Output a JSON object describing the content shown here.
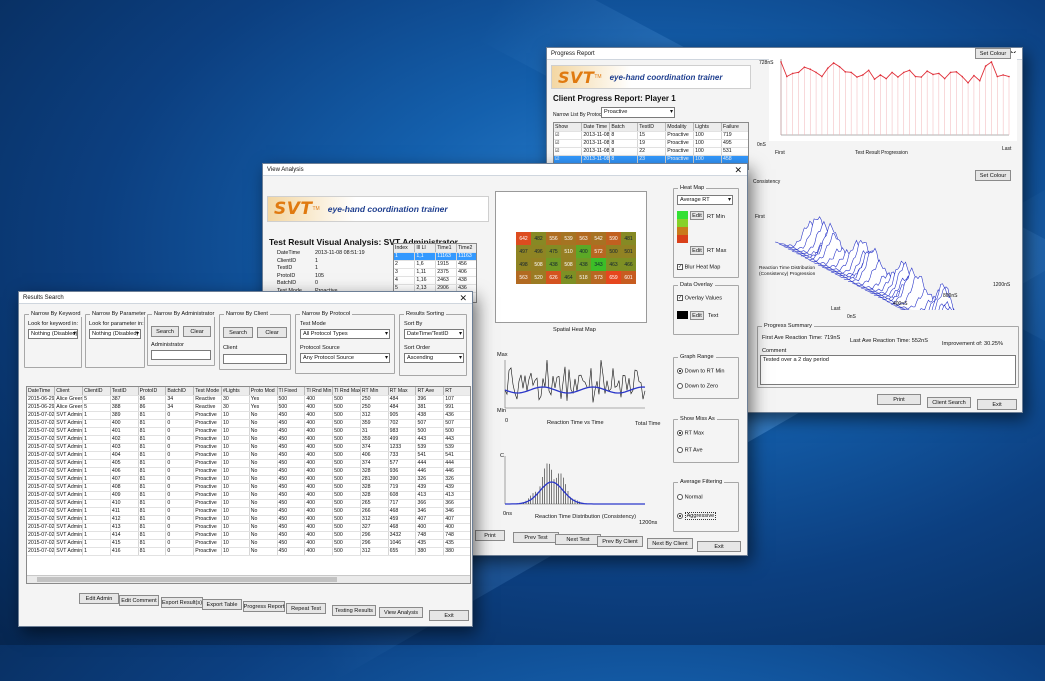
{
  "progress": {
    "title": "Progress Report",
    "logo": {
      "svt": "SVT",
      "tm": "TM",
      "tagline": "eye-hand coordination trainer"
    },
    "heading": "Client Progress Report: Player 1",
    "narrow_label": "Narrow List By Protocol",
    "narrow_value": "Proactive",
    "columns": [
      "Show",
      "Date Time",
      "Batch",
      "TestID",
      "Modality",
      "Lights",
      "Failure"
    ],
    "rows": [
      [
        "☑",
        "2013-11-08 13:04:37",
        "8",
        "15",
        "Proactive",
        "100",
        "719"
      ],
      [
        "☑",
        "2013-11-08 13:40:05",
        "8",
        "19",
        "Proactive",
        "100",
        "495"
      ],
      [
        "☑",
        "2013-11-08 13:55:52",
        "8",
        "22",
        "Proactive",
        "100",
        "531"
      ],
      [
        "☑",
        "2013-11-08 13:57:36",
        "8",
        "23",
        "Proactive",
        "100",
        "458"
      ],
      [
        "☑",
        "2013-11-08 14:00:11",
        "8",
        "24",
        "Proactive",
        "100",
        "446"
      ]
    ],
    "set_colour": "Set Colour",
    "line_chart": {
      "ymax": "728nS",
      "ymin": "0nS",
      "xfirst": "First",
      "xlabel": "Test Result Progression",
      "xlast": "Last",
      "values": [
        700,
        560,
        590,
        600,
        650,
        630,
        600,
        560,
        640,
        690,
        655,
        605,
        600,
        555,
        575,
        620,
        535,
        575,
        540,
        600,
        555,
        600,
        620,
        560,
        555,
        612,
        580,
        590,
        540,
        600,
        605,
        560,
        500,
        570,
        520,
        660,
        700,
        560,
        575,
        560
      ]
    },
    "dist3d": {
      "consistency": "Consistency",
      "first": "First",
      "last": "Last",
      "ylabel": "Reaction Time Distribution (Consistency) Progression",
      "x0": "0nS",
      "x400": "400nS",
      "x800": "800nS",
      "x1200": "1200nS"
    },
    "summary": {
      "legend": "Progress Summary",
      "first_ave": "First Ave Reaction Time: 719nS",
      "last_ave": "Last Ave Reaction Time: 552nS",
      "improvement": "Improvement of: 30.25%",
      "comment_label": "Comment",
      "comment": "Tested over a 2 day period"
    },
    "buttons": [
      "Print",
      "Client Search",
      "Exit"
    ]
  },
  "analysis": {
    "title": "View Analysis",
    "logo": {
      "svt": "SVT",
      "tm": "TM",
      "tagline": "eye-hand coordination trainer"
    },
    "heading": "Test Result Visual Analysis: SVT Administrator",
    "info": [
      [
        "DateTime",
        "2013-11-08 08:51:19"
      ],
      [
        "ClientID",
        "1"
      ],
      [
        "TestID",
        "1"
      ],
      [
        "ProtoID",
        "105"
      ],
      [
        "BatchID",
        "0"
      ],
      [
        "Test Mode",
        "Proactive"
      ],
      [
        "#Lights",
        "100"
      ]
    ],
    "idx_columns": [
      "Index",
      "Ill Ll",
      "Time1",
      "Time2"
    ],
    "idx_rows": [
      [
        "1",
        "1,1",
        "11163",
        "11163"
      ],
      [
        "2",
        "1,6",
        "1915",
        "456"
      ],
      [
        "3",
        "1,11",
        "2375",
        "406"
      ],
      [
        "4",
        "1,16",
        "2463",
        "438"
      ],
      [
        "5",
        "2,13",
        "2906",
        "436"
      ]
    ],
    "heatmap": [
      [
        642,
        482,
        556,
        539,
        563,
        542,
        590,
        481
      ],
      [
        497,
        496,
        475,
        510,
        400,
        572,
        500,
        501
      ],
      [
        498,
        508,
        438,
        508,
        438,
        343,
        463,
        466
      ],
      [
        563,
        520,
        626,
        464,
        518,
        573,
        659,
        601
      ]
    ],
    "heatmap_label": "Spatial Heat Map",
    "hm_group": "Heat Map",
    "hm_select": "Average RT",
    "edit": "Edit",
    "rt_min": "RT Min",
    "rt_max": "RT Max",
    "blur": "Blur Heat Map",
    "overlay_group": "Data Overlay",
    "overlay_values": "Overlay Values",
    "text_label": "Text",
    "rt_chart": {
      "max": "Max",
      "min": "Min",
      "x0": "0",
      "xlabel": "Reaction Time vs Time",
      "xend": "Total Time"
    },
    "dist_chart": {
      "c": "C",
      "x0": "0ns",
      "xlabel": "Reaction Time Distribution (Consistency)",
      "xend": "1200ns"
    },
    "graph_range": {
      "legend": "Graph Range",
      "opt1": "Down to RT Min",
      "opt2": "Down to Zero"
    },
    "show_miss": {
      "legend": "Show Miss As",
      "opt1": "RT Max",
      "opt2": "RT Ave"
    },
    "avg_filter": {
      "legend": "Average Filtering",
      "opt1": "Normal",
      "opt2": "Aggressive"
    },
    "buttons": [
      "Print",
      "Prev Test",
      "Next Test",
      "Prev By Client",
      "Next By Client",
      "Exit"
    ]
  },
  "search": {
    "title": "Results Search",
    "kw": {
      "legend": "Narrow By Keyword",
      "label": "Look for keyword in:",
      "value": "Nothing (Disabled)"
    },
    "param": {
      "legend": "Narrow By Parameter",
      "label": "Look for parameter in:",
      "value": "Nothing (Disabled)"
    },
    "admin": {
      "legend": "Narrow By Administrator",
      "search": "Search",
      "clear": "Clear",
      "label": "Administrator"
    },
    "client": {
      "legend": "Narrow By Client",
      "search": "Search",
      "clear": "Clear",
      "label": "Client"
    },
    "protocol": {
      "legend": "Narrow By Protocol",
      "mode_label": "Test Mode",
      "mode_value": "All Protocol Types",
      "source_label": "Protocol Source",
      "source_value": "Any Protocol Source"
    },
    "sorting": {
      "legend": "Results Sorting",
      "sort_label": "Sort By",
      "sort_value": "DateTime/TestID",
      "order_label": "Sort Order",
      "order_value": "Ascending"
    },
    "columns": [
      "DateTime",
      "Client",
      "ClientID",
      "TestID",
      "ProtoID",
      "BatchID",
      "Test Mode",
      "#Lights",
      "Proto Mod",
      "Tl Fixed",
      "Tl Rnd Min",
      "Tl Rnd Max",
      "RT Min",
      "RT Max",
      "RT Ave",
      "RT"
    ],
    "rows": [
      [
        "2015-06-29 23:24:57",
        "Alice Green",
        "5",
        "387",
        "86",
        "34",
        "Reactive",
        "30",
        "Yes",
        "500",
        "400",
        "500",
        "250",
        "484",
        "396",
        "107"
      ],
      [
        "2015-06-29 23:25:17",
        "Alice Green",
        "5",
        "388",
        "86",
        "34",
        "Reactive",
        "30",
        "Yes",
        "500",
        "400",
        "500",
        "250",
        "484",
        "381",
        "991"
      ],
      [
        "2015-07-02 08:58:14",
        "SVT Administrator",
        "1",
        "389",
        "81",
        "0",
        "Proactive",
        "10",
        "No",
        "450",
        "400",
        "500",
        "312",
        "905",
        "438",
        "436"
      ],
      [
        "2015-07-02 13:06:51",
        "SVT Administrator",
        "1",
        "400",
        "81",
        "0",
        "Proactive",
        "10",
        "No",
        "450",
        "400",
        "500",
        "359",
        "702",
        "507",
        "507"
      ],
      [
        "2015-07-02 13:07:01",
        "SVT Administrator",
        "1",
        "401",
        "81",
        "0",
        "Proactive",
        "10",
        "No",
        "450",
        "400",
        "500",
        "31",
        "983",
        "500",
        "500"
      ],
      [
        "2015-07-02 13:10:31",
        "SVT Administrator",
        "1",
        "402",
        "81",
        "0",
        "Proactive",
        "10",
        "No",
        "450",
        "400",
        "500",
        "359",
        "499",
        "443",
        "443"
      ],
      [
        "2015-07-02 13:14:25",
        "SVT Administrator",
        "1",
        "403",
        "81",
        "0",
        "Proactive",
        "10",
        "No",
        "450",
        "400",
        "500",
        "374",
        "1233",
        "539",
        "539"
      ],
      [
        "2015-07-02 13:18:23",
        "SVT Administrator",
        "1",
        "404",
        "81",
        "0",
        "Proactive",
        "10",
        "No",
        "450",
        "400",
        "500",
        "406",
        "733",
        "541",
        "541"
      ],
      [
        "2015-07-02 13:36:54",
        "SVT Administrator",
        "1",
        "405",
        "81",
        "0",
        "Proactive",
        "10",
        "No",
        "450",
        "400",
        "500",
        "374",
        "577",
        "444",
        "444"
      ],
      [
        "2015-07-02 13:41:12",
        "SVT Administrator",
        "1",
        "406",
        "81",
        "0",
        "Proactive",
        "10",
        "No",
        "450",
        "400",
        "500",
        "328",
        "936",
        "446",
        "446"
      ],
      [
        "2015-07-02 13:44:09",
        "SVT Administrator",
        "1",
        "407",
        "81",
        "0",
        "Proactive",
        "10",
        "No",
        "450",
        "400",
        "500",
        "281",
        "390",
        "326",
        "326"
      ],
      [
        "2015-07-02 13:48:20",
        "SVT Administrator",
        "1",
        "408",
        "81",
        "0",
        "Proactive",
        "10",
        "No",
        "450",
        "400",
        "500",
        "328",
        "719",
        "439",
        "439"
      ],
      [
        "2015-07-02 13:51:05",
        "SVT Administrator",
        "1",
        "409",
        "81",
        "0",
        "Proactive",
        "10",
        "No",
        "450",
        "400",
        "500",
        "328",
        "608",
        "413",
        "413"
      ],
      [
        "2015-07-02 13:54:03",
        "SVT Administrator",
        "1",
        "410",
        "81",
        "0",
        "Proactive",
        "10",
        "No",
        "450",
        "400",
        "500",
        "265",
        "717",
        "366",
        "366"
      ],
      [
        "2015-07-02 13:56:54",
        "SVT Administrator",
        "1",
        "411",
        "81",
        "0",
        "Proactive",
        "10",
        "No",
        "450",
        "400",
        "500",
        "266",
        "468",
        "346",
        "346"
      ],
      [
        "2015-07-02 13:58:34",
        "SVT Administrator",
        "1",
        "412",
        "81",
        "0",
        "Proactive",
        "10",
        "No",
        "450",
        "400",
        "500",
        "312",
        "459",
        "407",
        "407"
      ],
      [
        "2015-07-02 14:04:00",
        "SVT Administrator",
        "1",
        "413",
        "81",
        "0",
        "Proactive",
        "10",
        "No",
        "450",
        "400",
        "500",
        "327",
        "468",
        "400",
        "400"
      ],
      [
        "2015-07-02 14:07:07",
        "SVT Administrator",
        "1",
        "414",
        "81",
        "0",
        "Proactive",
        "10",
        "No",
        "450",
        "400",
        "500",
        "296",
        "3432",
        "748",
        "748"
      ],
      [
        "2015-07-02 14:07:16",
        "SVT Administrator",
        "1",
        "415",
        "81",
        "0",
        "Proactive",
        "10",
        "No",
        "450",
        "400",
        "500",
        "296",
        "1046",
        "435",
        "435"
      ],
      [
        "2015-07-02 14:07:56",
        "SVT Administrator",
        "1",
        "416",
        "81",
        "0",
        "Proactive",
        "10",
        "No",
        "450",
        "400",
        "500",
        "312",
        "655",
        "380",
        "380"
      ]
    ],
    "buttons": [
      "Edit Admin",
      "Edit Comment",
      "Export Result(s)",
      "Export Table",
      "Progress Report",
      "Repeat Test",
      "Testing Results",
      "View Analysis",
      "Exit"
    ]
  },
  "colors": {
    "brand_orange": "#e07a10",
    "brand_blue": "#1f3f8f",
    "line_red": "#e0303a",
    "dist_blue": "#2b37c9",
    "select_blue": "#3399ff"
  }
}
